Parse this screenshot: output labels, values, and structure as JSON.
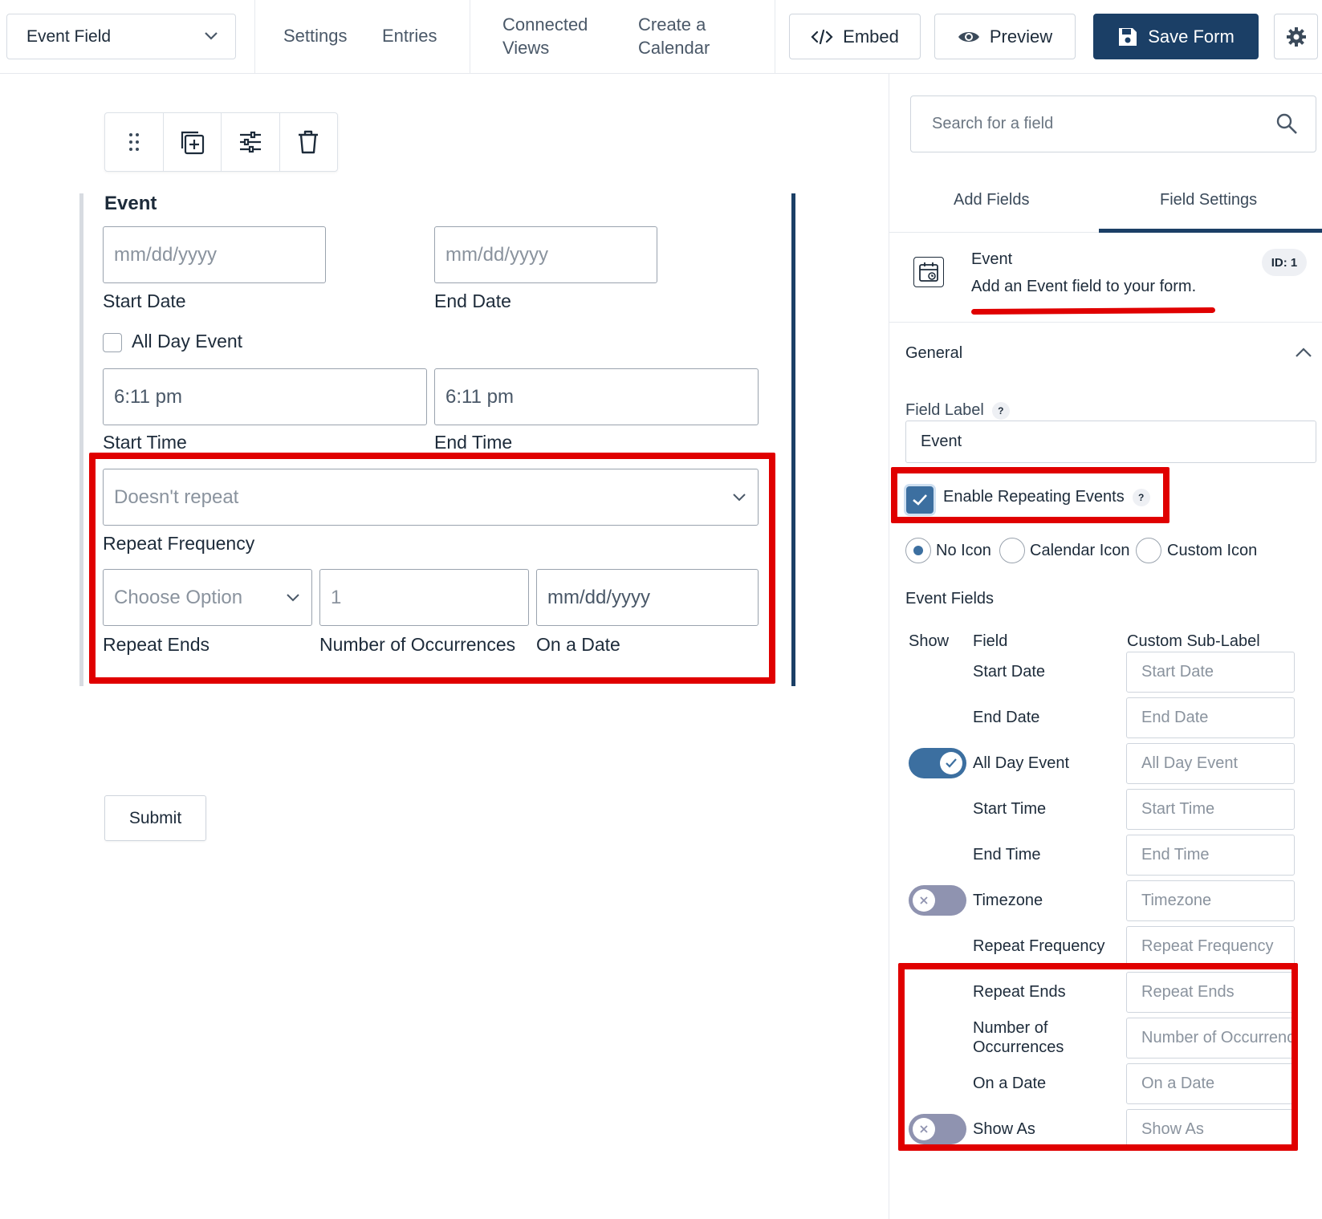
{
  "topbar": {
    "form_select": "Event Field",
    "nav": [
      "Settings",
      "Entries"
    ],
    "connected_views": [
      "Connected",
      "Views"
    ],
    "create_calendar": [
      "Create a",
      "Calendar"
    ],
    "embed_label": "Embed",
    "preview_label": "Preview",
    "save_label": "Save Form"
  },
  "canvas": {
    "field_title": "Event",
    "start_date_placeholder": "mm/dd/yyyy",
    "end_date_placeholder": "mm/dd/yyyy",
    "start_date_label": "Start Date",
    "end_date_label": "End Date",
    "all_day_label": "All Day Event",
    "start_time_value": "6:11 pm",
    "end_time_value": "6:11 pm",
    "start_time_label": "Start Time",
    "end_time_label": "End Time",
    "repeat_frequency_value": "Doesn't repeat",
    "repeat_frequency_label": "Repeat Frequency",
    "repeat_ends_value": "Choose Option",
    "occurrences_value": "1",
    "on_date_placeholder": "mm/dd/yyyy",
    "repeat_ends_label": "Repeat Ends",
    "occurrences_label": "Number of Occurrences",
    "on_date_label": "On a Date",
    "submit_label": "Submit"
  },
  "sidebar": {
    "search_placeholder": "Search for a field",
    "tabs": [
      "Add Fields",
      "Field Settings"
    ],
    "active_tab": "Field Settings",
    "field_name": "Event",
    "field_description": "Add an Event field to your form.",
    "field_id": "ID: 1",
    "section_title": "General",
    "field_label_title": "Field Label",
    "field_label_value": "Event",
    "enable_repeating_label": "Enable Repeating Events",
    "enable_repeating_checked": true,
    "icon_options": [
      "No Icon",
      "Calendar Icon",
      "Custom Icon"
    ],
    "icon_selected": "No Icon",
    "event_fields_title": "Event Fields",
    "columns": [
      "Show",
      "Field",
      "Custom Sub-Label"
    ],
    "rows": [
      {
        "field": "Start Date",
        "placeholder": "Start Date",
        "toggle": null
      },
      {
        "field": "End Date",
        "placeholder": "End Date",
        "toggle": null
      },
      {
        "field": "All Day Event",
        "placeholder": "All Day Event",
        "toggle": "on"
      },
      {
        "field": "Start Time",
        "placeholder": "Start Time",
        "toggle": null
      },
      {
        "field": "End Time",
        "placeholder": "End Time",
        "toggle": null
      },
      {
        "field": "Timezone",
        "placeholder": "Timezone",
        "toggle": "off"
      },
      {
        "field": "Repeat Frequency",
        "placeholder": "Repeat Frequency",
        "toggle": null
      },
      {
        "field": "Repeat Ends",
        "placeholder": "Repeat Ends",
        "toggle": null
      },
      {
        "field": "Number of Occurrences",
        "placeholder": "Number of Occurrences",
        "toggle": null
      },
      {
        "field": "On a Date",
        "placeholder": "On a Date",
        "toggle": null
      },
      {
        "field": "Show As",
        "placeholder": "Show As",
        "toggle": "off"
      }
    ]
  },
  "colors": {
    "primary": "#1b3f66",
    "accent": "#3c6fa0",
    "highlight": "#e00000"
  }
}
